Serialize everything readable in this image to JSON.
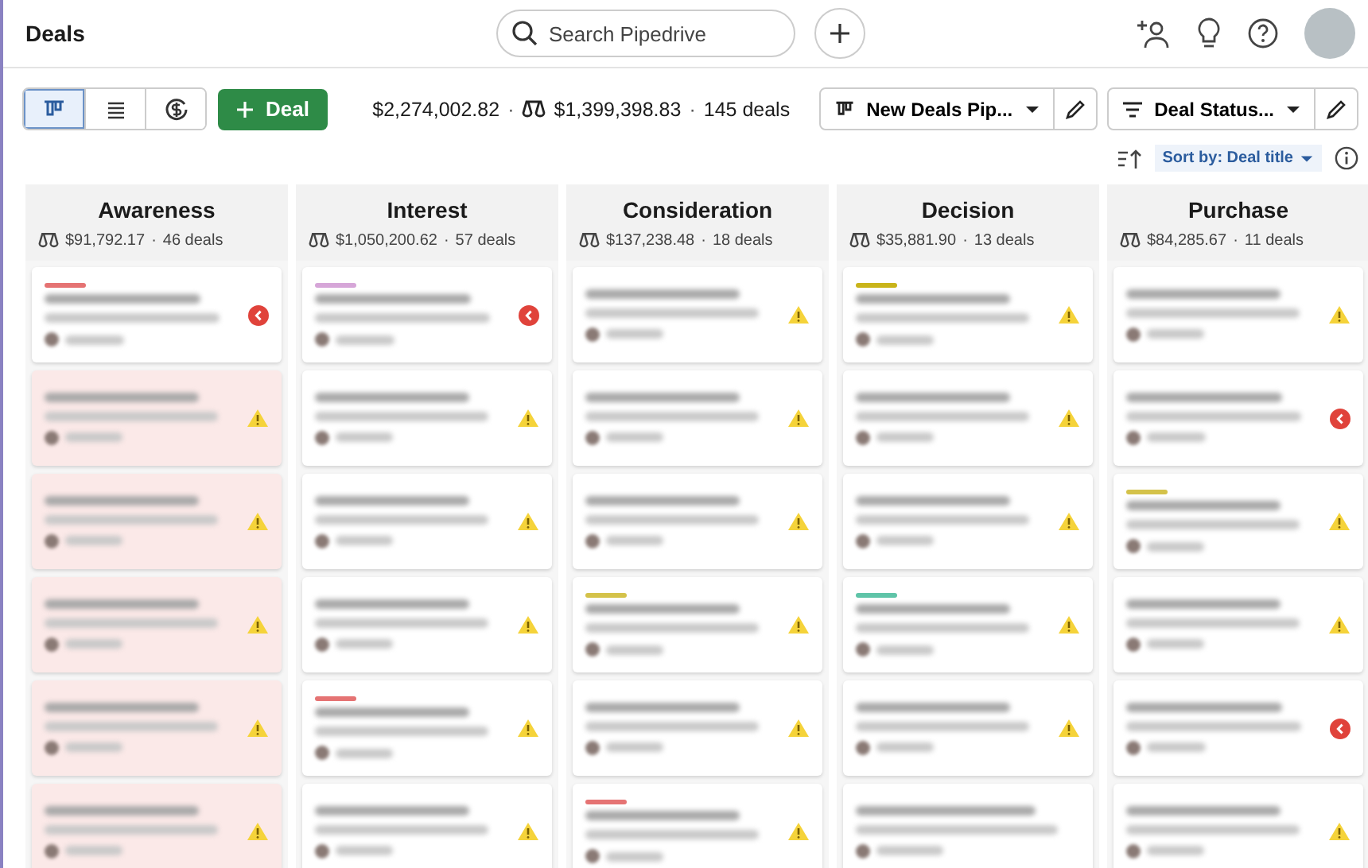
{
  "header": {
    "title": "Deals",
    "search": {
      "placeholder": "Search Pipedrive"
    }
  },
  "toolbar": {
    "views": [
      {
        "kind": "board",
        "selected": true
      },
      {
        "kind": "list",
        "selected": false
      },
      {
        "kind": "forecast",
        "selected": false
      }
    ],
    "add_button": "Deal",
    "total": "$2,274,002.82",
    "sep_1": "·",
    "weighted": "$1,399,398.83",
    "sep_2": "·",
    "count": "145 deals",
    "pipeline": "New Deals Pip...",
    "filter": "Deal Status..."
  },
  "sort": {
    "label": "Sort by:",
    "value": "Deal title"
  },
  "stages": [
    {
      "name": "Awareness",
      "value": "$91,792.17",
      "sep": "·",
      "count": "46 deals",
      "cards": [
        {
          "kind": "overdue",
          "rotten": false,
          "color": "#e57373"
        },
        {
          "kind": "warning",
          "rotten": true
        },
        {
          "kind": "warning",
          "rotten": true
        },
        {
          "kind": "warning",
          "rotten": true
        },
        {
          "kind": "warning",
          "rotten": true
        },
        {
          "kind": "warning",
          "rotten": true
        }
      ]
    },
    {
      "name": "Interest",
      "value": "$1,050,200.62",
      "sep": "·",
      "count": "57 deals",
      "cards": [
        {
          "kind": "overdue",
          "rotten": false,
          "color": "#d6a6d8"
        },
        {
          "kind": "warning",
          "rotten": false
        },
        {
          "kind": "warning",
          "rotten": false
        },
        {
          "kind": "warning",
          "rotten": false
        },
        {
          "kind": "warning",
          "rotten": false,
          "color": "#e57373"
        },
        {
          "kind": "warning",
          "rotten": false
        }
      ]
    },
    {
      "name": "Consideration",
      "value": "$137,238.48",
      "sep": "·",
      "count": "18 deals",
      "cards": [
        {
          "kind": "warning",
          "rotten": false
        },
        {
          "kind": "warning",
          "rotten": false
        },
        {
          "kind": "warning",
          "rotten": false
        },
        {
          "kind": "warning",
          "rotten": false,
          "color": "#d4c24a"
        },
        {
          "kind": "warning",
          "rotten": false
        },
        {
          "kind": "warning",
          "rotten": false,
          "color": "#e57373"
        }
      ]
    },
    {
      "name": "Decision",
      "value": "$35,881.90",
      "sep": "·",
      "count": "13 deals",
      "cards": [
        {
          "kind": "warning",
          "rotten": false,
          "color": "#c9b41a"
        },
        {
          "kind": "warning",
          "rotten": false
        },
        {
          "kind": "warning",
          "rotten": false
        },
        {
          "kind": "warning",
          "rotten": false,
          "color": "#5fc4a8"
        },
        {
          "kind": "warning",
          "rotten": false
        },
        {
          "kind": "plain",
          "rotten": false
        }
      ]
    },
    {
      "name": "Purchase",
      "value": "$84,285.67",
      "sep": "·",
      "count": "11 deals",
      "cards": [
        {
          "kind": "warning",
          "rotten": false
        },
        {
          "kind": "overdue",
          "rotten": false
        },
        {
          "kind": "warning",
          "rotten": false,
          "color": "#d4c24a"
        },
        {
          "kind": "warning",
          "rotten": false
        },
        {
          "kind": "overdue",
          "rotten": false
        },
        {
          "kind": "warning",
          "rotten": false
        }
      ]
    }
  ]
}
